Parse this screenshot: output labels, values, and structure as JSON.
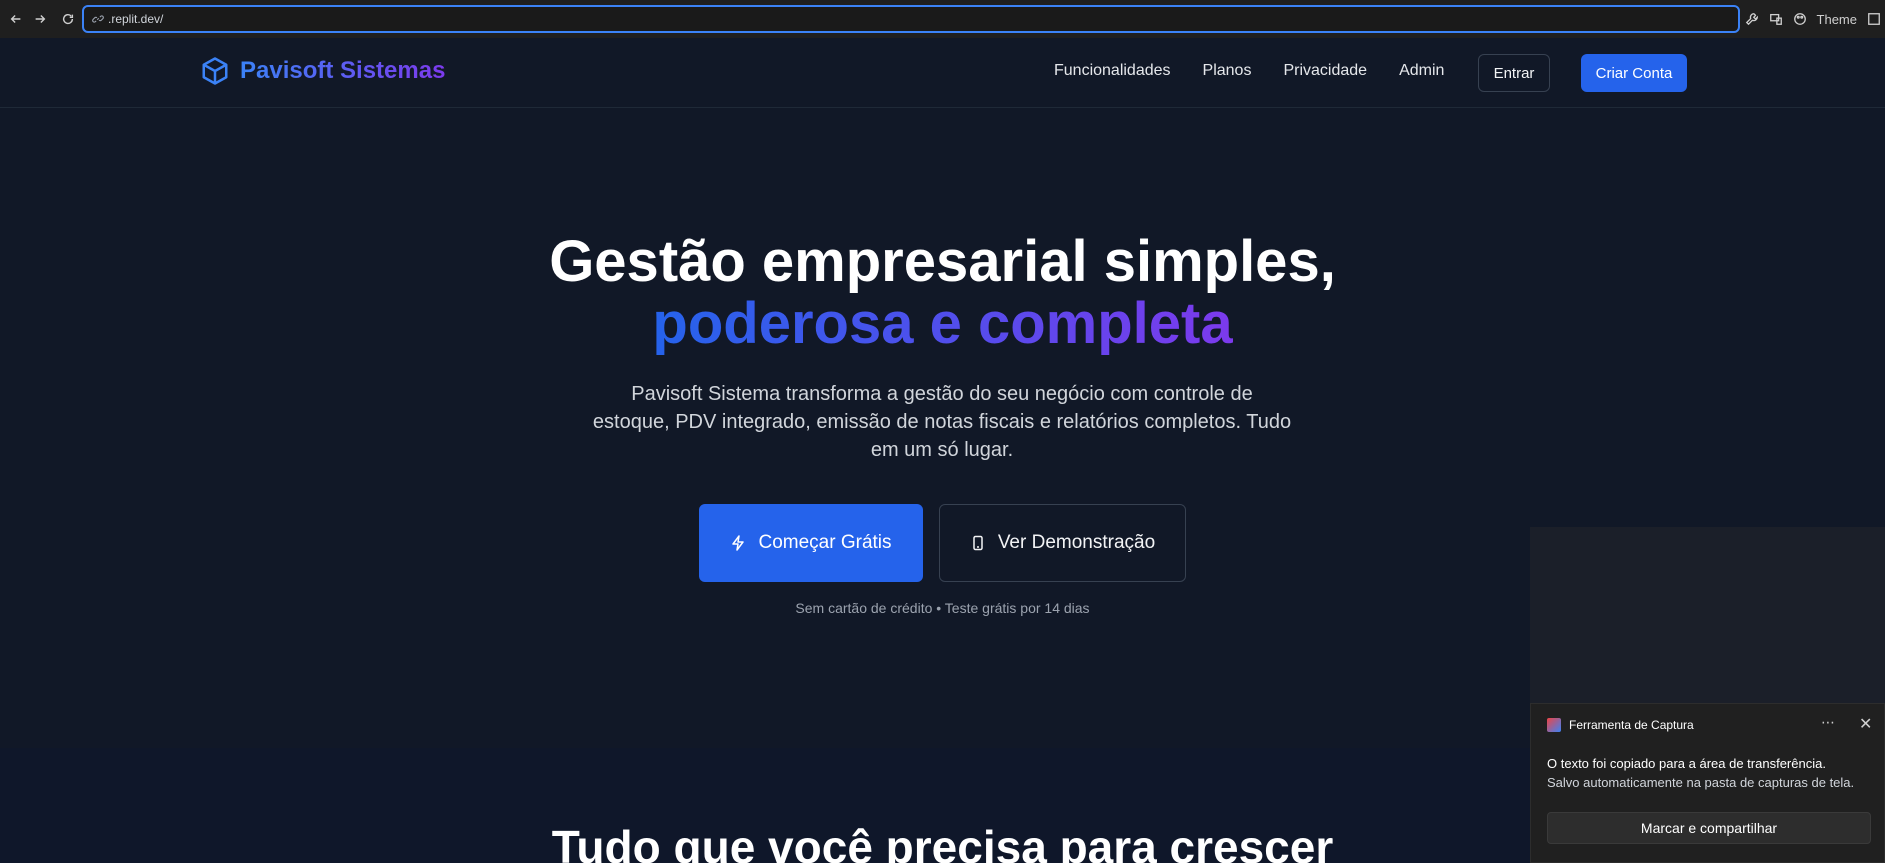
{
  "browser": {
    "url": ".replit.dev/",
    "theme_label": "Theme"
  },
  "header": {
    "brand": "Pavisoft Sistemas",
    "nav": [
      "Funcionalidades",
      "Planos",
      "Privacidade",
      "Admin"
    ],
    "login": "Entrar",
    "signup": "Criar Conta"
  },
  "hero": {
    "title_line1": "Gestão empresarial simples,",
    "title_line2": "poderosa e completa",
    "description": "Pavisoft Sistema transforma a gestão do seu negócio com controle de estoque, PDV integrado, emissão de notas fiscais e relatórios completos. Tudo em um só lugar.",
    "cta_primary": "Começar Grátis",
    "cta_secondary": "Ver Demonstração",
    "note": "Sem cartão de crédito • Teste grátis por 14 dias"
  },
  "section2": {
    "title": "Tudo que você precisa para crescer"
  },
  "toast": {
    "app_name": "Ferramenta de Captura",
    "message1": "O texto foi copiado para a área de transferência.",
    "message2": "Salvo automaticamente na pasta de capturas de tela.",
    "action": "Marcar e compartilhar"
  },
  "colors": {
    "accent": "#2563eb",
    "gradient_end": "#7c3aed",
    "background": "#111827"
  }
}
